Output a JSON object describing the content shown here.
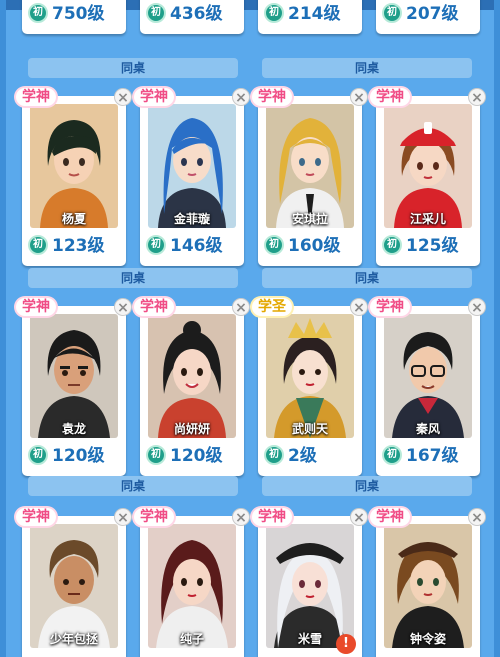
{
  "partner_label": "同桌",
  "close_glyph": "×",
  "rows": [
    {
      "cards": [
        {
          "name": "",
          "stage": "初",
          "level": "750级"
        },
        {
          "name": "",
          "stage": "初",
          "level": "436级"
        },
        {
          "name": "",
          "stage": "初",
          "level": "214级"
        },
        {
          "name": "",
          "stage": "初",
          "level": "207级"
        }
      ]
    },
    {
      "cards": [
        {
          "name": "杨夏",
          "badge": "学神",
          "stage": "初",
          "level": "123级",
          "colors": {
            "bg": "#e7c79d",
            "hair": "#1b2a1f",
            "cloth": "#d77b2b",
            "skin": "#f6d2b5"
          }
        },
        {
          "name": "金菲璇",
          "badge": "学神",
          "stage": "初",
          "level": "146级",
          "colors": {
            "bg": "#bcd8e8",
            "hair": "#2a6fc7",
            "cloth": "#2b3446",
            "skin": "#f7dcc9"
          }
        },
        {
          "name": "安琪拉",
          "badge": "学神",
          "stage": "初",
          "level": "160级",
          "colors": {
            "bg": "#d3c4a6",
            "hair": "#e2b23a",
            "cloth": "#f0f0f0",
            "skin": "#f8ddc8"
          }
        },
        {
          "name": "江采儿",
          "badge": "学神",
          "stage": "初",
          "level": "125级",
          "colors": {
            "bg": "#e9d2c4",
            "hair": "#8a4b22",
            "cloth": "#d8232a",
            "skin": "#f6d8c4"
          }
        }
      ]
    },
    {
      "cards": [
        {
          "name": "袁龙",
          "badge": "学神",
          "stage": "初",
          "level": "120级",
          "colors": {
            "bg": "#cfc7bc",
            "hair": "#1a1a1a",
            "cloth": "#2a2a2a",
            "skin": "#d9a07a"
          }
        },
        {
          "name": "尚妍妍",
          "badge": "学神",
          "stage": "初",
          "level": "120级",
          "colors": {
            "bg": "#d7c2b0",
            "hair": "#1c1c1c",
            "cloth": "#c9412e",
            "skin": "#f6d7c6"
          }
        },
        {
          "name": "武则天",
          "badge": "学圣",
          "stage": "初",
          "level": "2级",
          "colors": {
            "bg": "#e0cfaa",
            "hair": "#2b2020",
            "cloth": "#d49a2b",
            "skin": "#f8e0d0"
          }
        },
        {
          "name": "秦风",
          "badge": "学神",
          "stage": "初",
          "level": "167级",
          "colors": {
            "bg": "#d6d0c8",
            "hair": "#1b1b1b",
            "cloth": "#262b3a",
            "skin": "#f1c9ab"
          }
        }
      ]
    },
    {
      "cards": [
        {
          "name": "少年包拯",
          "badge": "学神",
          "colors": {
            "bg": "#dcd3c6",
            "hair": "#6b4a2a",
            "cloth": "#f2f2f2",
            "skin": "#c98e64"
          }
        },
        {
          "name": "纯子",
          "badge": "学神",
          "colors": {
            "bg": "#e3cfc8",
            "hair": "#5a1b1b",
            "cloth": "#efefef",
            "skin": "#f6d7c6"
          }
        },
        {
          "name": "米雪",
          "badge": "学神",
          "alert": "!",
          "colors": {
            "bg": "#d8d5d6",
            "hair": "#eef0f4",
            "cloth": "#2b2b2b",
            "skin": "#f8e0d6"
          }
        },
        {
          "name": "钟令姿",
          "badge": "学神",
          "colors": {
            "bg": "#d9c6a8",
            "hair": "#7a4a20",
            "cloth": "#1e1e1e",
            "skin": "#f3d3b8"
          }
        }
      ]
    }
  ]
}
